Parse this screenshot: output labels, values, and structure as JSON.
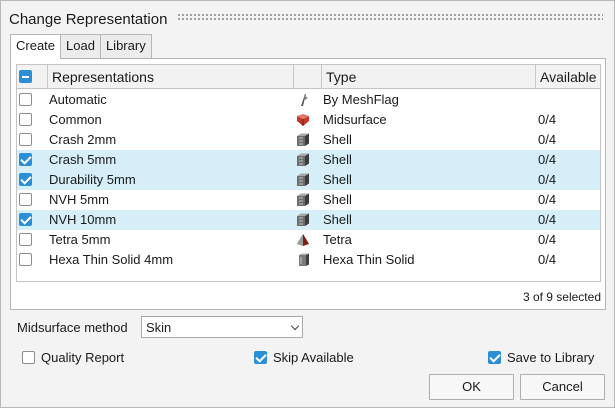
{
  "dialog": {
    "title": "Change Representation"
  },
  "tabs": [
    {
      "label": "Create",
      "active": true
    },
    {
      "label": "Load",
      "active": false
    },
    {
      "label": "Library",
      "active": false
    }
  ],
  "table": {
    "columns": [
      "Representations",
      "",
      "Type",
      "Available"
    ],
    "header_checkbox": "partial",
    "rows": [
      {
        "checked": false,
        "name": "Automatic",
        "icon": "meshflag-icon",
        "type": "By MeshFlag",
        "available": ""
      },
      {
        "checked": false,
        "name": "Common",
        "icon": "midsurface-icon",
        "type": "Midsurface",
        "available": "0/4"
      },
      {
        "checked": false,
        "name": "Crash 2mm",
        "icon": "shell-icon",
        "type": "Shell",
        "available": "0/4"
      },
      {
        "checked": true,
        "name": "Crash 5mm",
        "icon": "shell-icon",
        "type": "Shell",
        "available": "0/4"
      },
      {
        "checked": true,
        "name": "Durability 5mm",
        "icon": "shell-icon",
        "type": "Shell",
        "available": "0/4"
      },
      {
        "checked": false,
        "name": "NVH 5mm",
        "icon": "shell-icon",
        "type": "Shell",
        "available": "0/4"
      },
      {
        "checked": true,
        "name": "NVH 10mm",
        "icon": "shell-icon",
        "type": "Shell",
        "available": "0/4"
      },
      {
        "checked": false,
        "name": "Tetra 5mm",
        "icon": "tetra-icon",
        "type": "Tetra",
        "available": "0/4"
      },
      {
        "checked": false,
        "name": "Hexa Thin Solid 4mm",
        "icon": "hexa-thin-solid-icon",
        "type": "Hexa Thin Solid",
        "available": "0/4"
      }
    ],
    "selection_count": "3 of 9 selected"
  },
  "midsurface": {
    "label": "Midsurface method",
    "value": "Skin"
  },
  "options": {
    "quality_report": {
      "label": "Quality Report",
      "checked": false
    },
    "skip_available": {
      "label": "Skip Available",
      "checked": true
    },
    "save_to_library": {
      "label": "Save to Library",
      "checked": true
    }
  },
  "buttons": {
    "ok": "OK",
    "cancel": "Cancel"
  },
  "colors": {
    "selected_row": "#d5eef8",
    "checkbox_accent": "#2c8fd6"
  }
}
